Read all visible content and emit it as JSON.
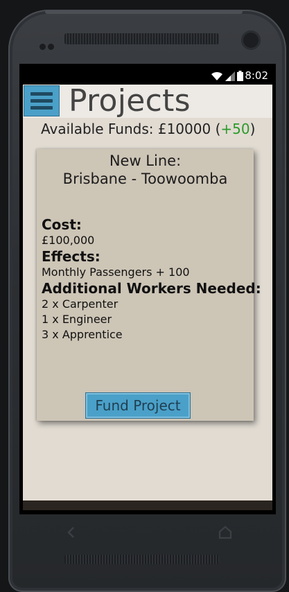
{
  "status_bar": {
    "time": "8:02",
    "icons": [
      "wifi-icon",
      "signal-icon",
      "battery-icon"
    ]
  },
  "header": {
    "title": "Projects",
    "menu_icon": "hamburger-menu-icon"
  },
  "funds": {
    "label": "Available Funds: £10000 (",
    "delta": "+50",
    "suffix": ")"
  },
  "project_card": {
    "title_line1": "New Line:",
    "title_line2": "Brisbane - Toowoomba",
    "cost_label": "Cost:",
    "cost_value": "£100,000",
    "effects_label": "Effects:",
    "effects_value": "Monthly Passengers + 100",
    "workers_label": "Additional Workers Needed:",
    "workers": [
      "2 x Carpenter",
      "1 x Engineer",
      "3 x Apprentice"
    ],
    "fund_button_label": "Fund Project"
  },
  "colors": {
    "accent_button": "#4aa0c8",
    "positive_delta": "#2a9a2a",
    "card_background": "#cdc5b6",
    "screen_background": "#e1dbd2"
  }
}
